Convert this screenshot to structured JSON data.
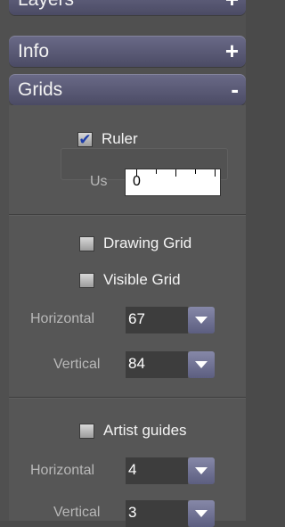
{
  "accordion": {
    "layers": {
      "title": "Layers",
      "sign": "+"
    },
    "info": {
      "title": "Info",
      "sign": "+"
    },
    "grids": {
      "title": "Grids",
      "sign": "-"
    }
  },
  "grids": {
    "ruler": {
      "label": "Ruler",
      "checked": true,
      "checkmark": "✔"
    },
    "us": {
      "label": "Us",
      "value": "0"
    },
    "drawing_grid": {
      "label": "Drawing Grid",
      "checked": false
    },
    "visible_grid": {
      "label": "Visible Grid",
      "checked": false
    },
    "grid_horizontal": {
      "label": "Horizontal",
      "value": "67"
    },
    "grid_vertical": {
      "label": "Vertical",
      "value": "84"
    },
    "artist_guides": {
      "label": "Artist guides",
      "checked": false
    },
    "guides_horizontal": {
      "label": "Horizontal",
      "value": "4"
    },
    "guides_vertical": {
      "label": "Vertical",
      "value": "3"
    }
  },
  "colors": {
    "header_top": "#6a6a88",
    "header_bottom": "#4b4b64",
    "panel": "#565656",
    "checkmark": "#1f3ea8"
  }
}
